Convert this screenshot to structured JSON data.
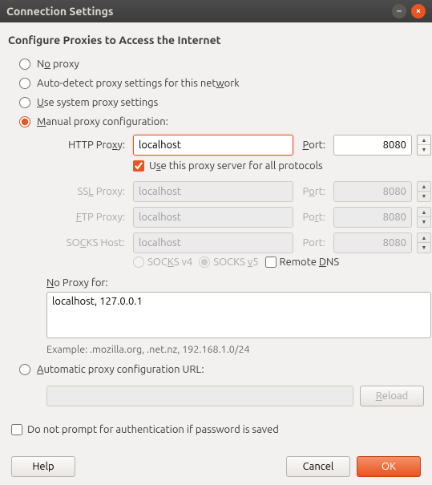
{
  "window": {
    "title": "Connection Settings"
  },
  "heading": "Configure Proxies to Access the Internet",
  "radios": {
    "no_proxy": "No proxy",
    "auto_detect_pre": "Auto-detect proxy settings for this net",
    "auto_detect_u": "w",
    "auto_detect_post": "ork",
    "system_u": "U",
    "system_post": "se system proxy settings",
    "manual_u": "M",
    "manual_post": "anual proxy configuration:",
    "pac_u": "A",
    "pac_post": "utomatic proxy configuration URL:"
  },
  "labels": {
    "http_pre": "HTTP Pro",
    "http_u": "x",
    "http_post": "y:",
    "port_u": "P",
    "port_post": "ort:",
    "port_plain": "Port:",
    "ssl_pre": "SS",
    "ssl_u": "L",
    "ssl_post": " Proxy:",
    "ftp_u": "F",
    "ftp_post": "TP Proxy:",
    "socks_pre": "SO",
    "socks_u": "C",
    "socks_post": "KS Host:",
    "use_all_pre": "U",
    "use_all_u": "s",
    "use_all_post": "e this proxy server for all protocols",
    "socks4_pre": "SOC",
    "socks4_u": "K",
    "socks4_post": "S v4",
    "socks5_pre": "SOCKS ",
    "socks5_u": "v",
    "socks5_post": "5",
    "remote_pre": "Remote ",
    "remote_u": "D",
    "remote_post": "NS",
    "noproxy_u": "N",
    "noproxy_post": "o Proxy for:",
    "example": "Example: .mozilla.org, .net.nz, 192.168.1.0/24"
  },
  "values": {
    "http_host": "localhost",
    "http_port": "8080",
    "ssl_host": "localhost",
    "ssl_port": "8080",
    "ftp_host": "localhost",
    "ftp_port": "8080",
    "socks_host": "localhost",
    "socks_port": "8080",
    "no_proxy": "localhost, 127.0.0.1",
    "pac_url": ""
  },
  "checkboxes": {
    "no_prompt": "Do not prompt for authentication if password is saved"
  },
  "buttons": {
    "reload_u": "R",
    "reload_post": "eload",
    "help": "Help",
    "cancel": "Cancel",
    "ok": "OK"
  }
}
